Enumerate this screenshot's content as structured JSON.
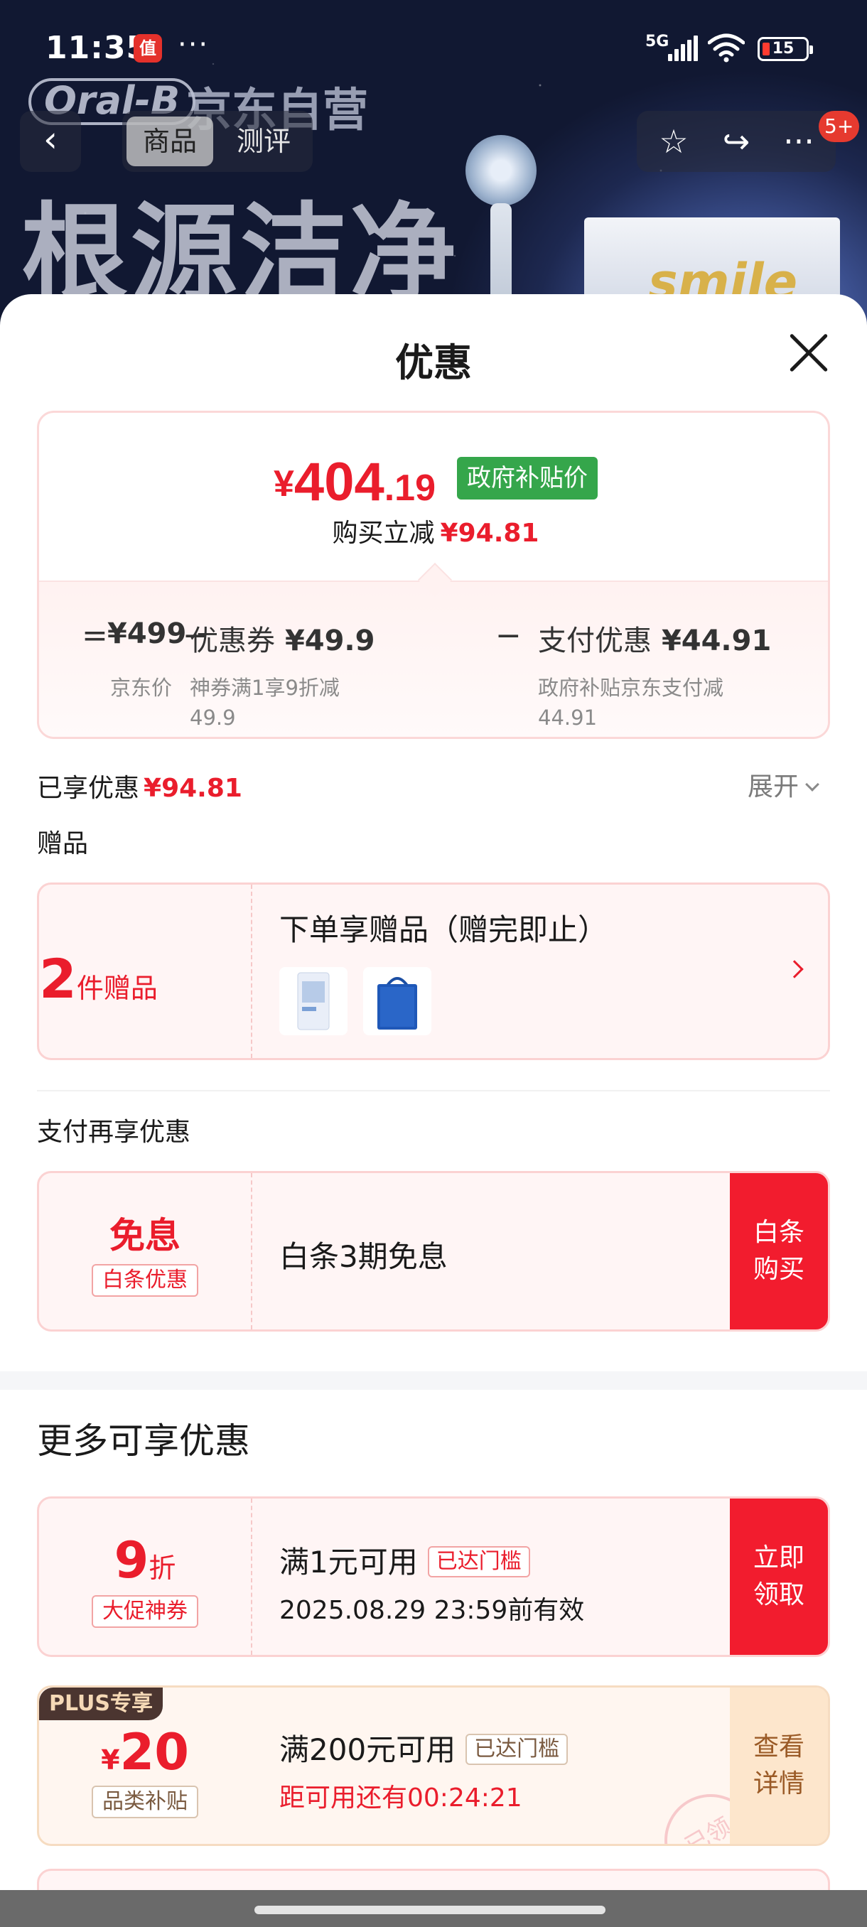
{
  "status_bar": {
    "time": "11:35",
    "app_badge": "值",
    "more": "···",
    "network": "5G",
    "battery": "15"
  },
  "product_page": {
    "brand": "Oral-B",
    "brand_store": "京东自营",
    "headline": "根源洁净",
    "tab_product": "商品",
    "tab_review": "测评",
    "back_icon": "‹",
    "star_icon": "☆",
    "share_icon": "↪",
    "more_icon": "···",
    "message_badge": "5+",
    "box_text": "smile"
  },
  "sheet": {
    "title": "优惠",
    "summary": {
      "currency": "¥",
      "price_int": "404",
      "price_dec": ".19",
      "gov_tag": "政府补贴价",
      "instant_label": "购买立减",
      "instant_value": "¥94.81",
      "op_eq": "=",
      "op_minus": "−",
      "jd_price": "¥499",
      "jd_price_label": "京东价",
      "coupon_label": "优惠券",
      "coupon_value": "¥49.9",
      "coupon_desc_1": "神券满1享9折减",
      "coupon_desc_2": "49.9",
      "pay_label": "支付优惠",
      "pay_value": "¥44.91",
      "pay_desc_1": "政府补贴京东支付减",
      "pay_desc_2": "44.91"
    },
    "enjoyed_label": "已享优惠",
    "enjoyed_value": "¥94.81",
    "expand_label": "展开",
    "gifts": {
      "section_label": "赠品",
      "count": "2",
      "count_unit": "件赠品",
      "title": "下单享赠品（赠完即止）"
    },
    "pay_more": {
      "section_label": "支付再享优惠",
      "big": "免息",
      "tag": "白条优惠",
      "desc": "白条3期免息",
      "button": "白条购买"
    },
    "more_offers": {
      "title": "更多可享优惠",
      "coupon1": {
        "big_num": "9",
        "big_unit": "折",
        "tag": "大促神券",
        "condition": "满1元可用",
        "reached": "已达门槛",
        "expiry": "2025.08.29 23:59前有效",
        "button": "立即领取"
      },
      "coupon2": {
        "plus_tag": "PLUS专享",
        "currency": "¥",
        "amount": "20",
        "tag": "品类补贴",
        "condition": "满200元可用",
        "reached": "已达门槛",
        "countdown": "距可用还有00:24:21",
        "button": "查看详情",
        "stamp": "已领"
      }
    }
  },
  "colors": {
    "accent_red": "#ea1d2c",
    "gov_green": "#35a64b",
    "plus_brown": "#4b3530"
  }
}
